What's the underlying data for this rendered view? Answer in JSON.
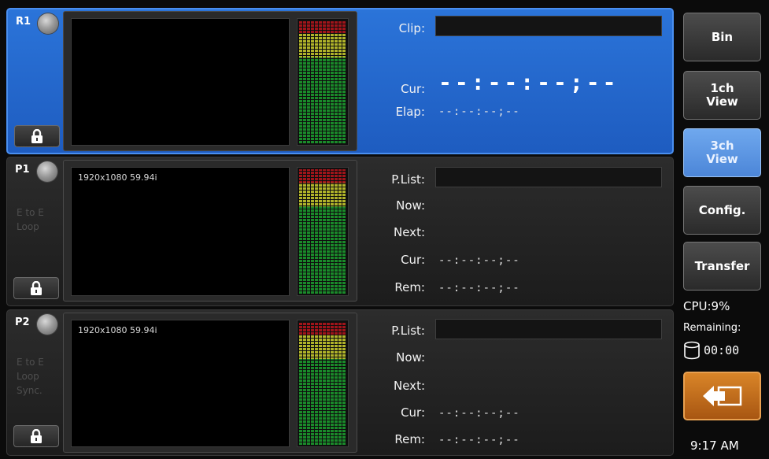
{
  "channels": [
    {
      "id": "R1",
      "active": true,
      "mode_lines": [],
      "format": "",
      "fields": {
        "clip_label": "Clip:",
        "cur_label": "Cur:",
        "cur_value": "--:--:--;--",
        "elap_label": "Elap:",
        "elap_value": "--:--:--;--"
      }
    },
    {
      "id": "P1",
      "active": false,
      "mode_lines": [
        "E to E",
        "Loop"
      ],
      "format": "1920x1080 59.94i",
      "fields": {
        "plist_label": "P.List:",
        "now_label": "Now:",
        "next_label": "Next:",
        "cur_label": "Cur:",
        "cur_value": "--:--:--;--",
        "rem_label": "Rem:",
        "rem_value": "--:--:--;--"
      }
    },
    {
      "id": "P2",
      "active": false,
      "mode_lines": [
        "E to E",
        "Loop",
        "Sync."
      ],
      "format": "1920x1080 59.94i",
      "fields": {
        "plist_label": "P.List:",
        "now_label": "Now:",
        "next_label": "Next:",
        "cur_label": "Cur:",
        "cur_value": "--:--:--;--",
        "rem_label": "Rem:",
        "rem_value": "--:--:--;--"
      }
    }
  ],
  "sidebar": {
    "buttons": [
      {
        "label": "Bin",
        "selected": false
      },
      {
        "label": "1ch\nView",
        "selected": false
      },
      {
        "label": "3ch\nView",
        "selected": true
      },
      {
        "label": "Config.",
        "selected": false
      },
      {
        "label": "Transfer",
        "selected": false
      }
    ],
    "cpu": "CPU:9%",
    "remaining_label": "Remaining:",
    "remaining_value": "00:00",
    "clock": "9:17 AM"
  },
  "icons": [
    "lock-icon",
    "knob-icon",
    "database-icon",
    "back-arrow-icon"
  ],
  "colors": {
    "active_channel": "#2b74d9",
    "selected_button": "#6fa8ee",
    "back_button": "#c9721e",
    "meter_red": "#a0141a",
    "meter_yellow": "#b0b32a",
    "meter_green": "#1a8a2a"
  }
}
